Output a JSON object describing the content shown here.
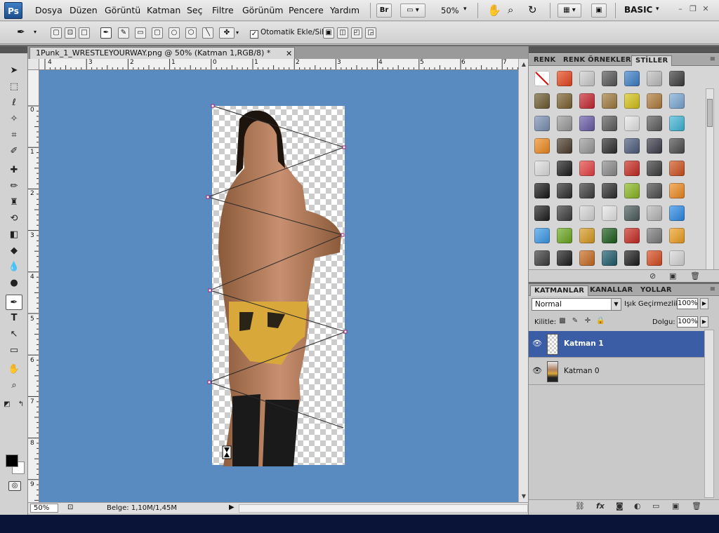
{
  "app": {
    "logo": "Ps",
    "menu": [
      "Dosya",
      "Düzen",
      "Görüntü",
      "Katman",
      "Seç",
      "Filtre",
      "Görünüm",
      "Pencere",
      "Yardım"
    ],
    "bridge_label": "Br",
    "zoom": "50%",
    "workspace": "BASIC"
  },
  "options": {
    "auto_add_label": "Otomatik Ekle/Sil",
    "auto_add_checked": true
  },
  "document": {
    "tab_title": "1Punk_1_WRESTLEYOURWAY.png @ 50% (Katman 1,RGB/8) *",
    "ruler_h": [
      "4",
      "3",
      "2",
      "1",
      "0",
      "1",
      "2",
      "3",
      "4",
      "5",
      "6",
      "7"
    ],
    "ruler_v": [
      "0",
      "1",
      "2",
      "3",
      "4",
      "5",
      "6",
      "7",
      "8",
      "9"
    ],
    "canvas_bg": "#5a8bc0",
    "status_zoom": "50%",
    "doc_size": "Belge: 1,10M/1,45M"
  },
  "styles_panel": {
    "tabs": [
      "RENK",
      "RENK ÖRNEKLERİ",
      "STİLLER"
    ],
    "active_tab": "STİLLER",
    "swatches": [
      "none",
      "#e8441a",
      "#cfcfcf",
      "#555555",
      "#3a7fc8",
      "#bfbfbf",
      "#3b3b3b",
      "#6d5a2e",
      "#7a5f2c",
      "#c8242e",
      "#a07a3a",
      "#d8c414",
      "#b07a3a",
      "#7aa8d6",
      "#7a90b4",
      "#9a9a9a",
      "#6a5aa8",
      "#5a5a5a",
      "#e8e8e8",
      "#5a5a5a",
      "#3fb6d8",
      "#f08a1e",
      "#4a3a2a",
      "#9a9a9a",
      "#2a2a2a",
      "#4a5a7a",
      "#3a3a4a",
      "#4a4a4a",
      "#e0e0e0",
      "#1a1a1a",
      "#e84040",
      "#8a8a8a",
      "#c8281e",
      "#3a3a3a",
      "#d0501a",
      "#141414",
      "#2a2a2a",
      "#3a3a3a",
      "#2a2a2a",
      "#8ab81e",
      "#4a4a4a",
      "#f08a1e",
      "#1a1a1a",
      "#3a3a3a",
      "#d8d8d8",
      "#e8e8e8",
      "#4a5a5a",
      "#b8b8b8",
      "#2a8ae8",
      "#3a9ae8",
      "#6aa81e",
      "#d89a1e",
      "#1a5a1a",
      "#c8281e",
      "#7a7a7a",
      "#f0a01e",
      "#3a3a3a",
      "#1a1a1a",
      "#c86a1e",
      "#1a5a6a",
      "#1a1a1a",
      "#d84a1e",
      "#d8d8d8"
    ]
  },
  "layers_panel": {
    "tabs": [
      "KATMANLAR",
      "KANALLAR",
      "YOLLAR"
    ],
    "active_tab": "KATMANLAR",
    "blend_mode": "Normal",
    "opacity_label": "Işık Geçirmezlik:",
    "opacity": "100%",
    "lock_label": "Kilitle:",
    "fill_label": "Dolgu:",
    "fill": "100%",
    "layers": [
      {
        "name": "Katman 1",
        "selected": true,
        "visible": true
      },
      {
        "name": "Katman 0",
        "selected": false,
        "visible": true
      }
    ]
  }
}
